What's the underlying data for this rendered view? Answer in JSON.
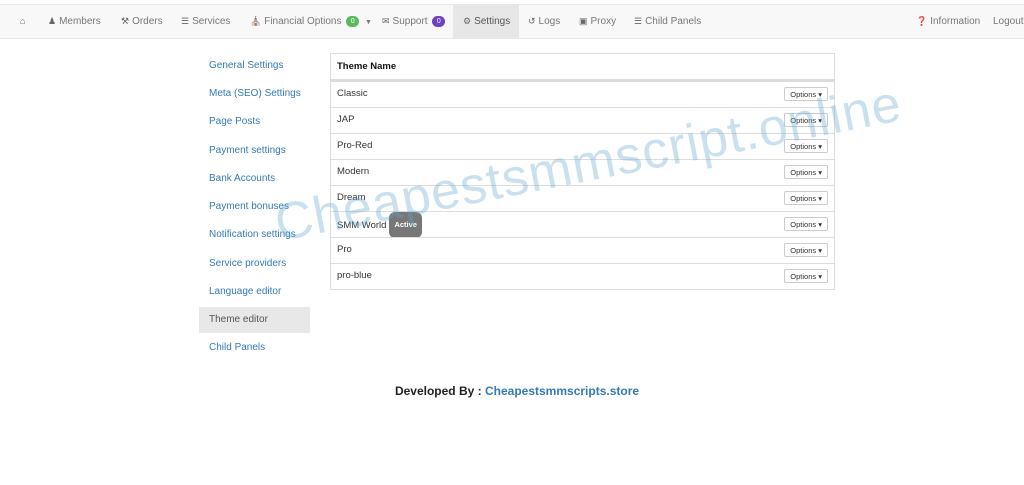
{
  "nav": {
    "items": [
      {
        "label": "",
        "icon": "home-icon"
      },
      {
        "label": "Members",
        "icon": "users-icon"
      },
      {
        "label": "Orders",
        "icon": "cart-icon"
      },
      {
        "label": "Services",
        "icon": "list-icon"
      },
      {
        "label": "Financial Options",
        "icon": "bank-icon",
        "badge": "0",
        "badge_color": "#5cb85c"
      },
      {
        "label": "Support",
        "icon": "comments-icon",
        "badge": "0",
        "badge_color": "#6f42c1"
      },
      {
        "label": "Settings",
        "icon": "gear-icon"
      },
      {
        "label": "Logs",
        "icon": "history-icon"
      },
      {
        "label": "Proxy",
        "icon": "lock-icon"
      },
      {
        "label": "Child Panels",
        "icon": "list-icon"
      },
      {
        "label": "Information",
        "icon": "question-icon"
      },
      {
        "label": "Logout",
        "icon": ""
      }
    ]
  },
  "sidebar": {
    "items": [
      {
        "label": "General Settings"
      },
      {
        "label": "Meta (SEO) Settings"
      },
      {
        "label": "Page Posts"
      },
      {
        "label": "Payment settings"
      },
      {
        "label": "Bank Accounts"
      },
      {
        "label": "Payment bonuses"
      },
      {
        "label": "Notification settings"
      },
      {
        "label": "Service providers"
      },
      {
        "label": "Language editor"
      },
      {
        "label": "Theme editor"
      },
      {
        "label": "Child Panels"
      }
    ]
  },
  "themes": {
    "header": "Theme Name",
    "options_label": "Options",
    "active_label": "Active",
    "rows": [
      {
        "name": "Classic"
      },
      {
        "name": "JAP"
      },
      {
        "name": "Pro-Red"
      },
      {
        "name": "Modern"
      },
      {
        "name": "Dream"
      },
      {
        "name": "SMM World",
        "active": true
      },
      {
        "name": "Pro"
      },
      {
        "name": "pro-blue"
      }
    ]
  },
  "footer": {
    "prefix": "Developed By : ",
    "link": "Cheapestsmmscripts.store"
  },
  "watermark": "Cheapestsmmscript.online"
}
